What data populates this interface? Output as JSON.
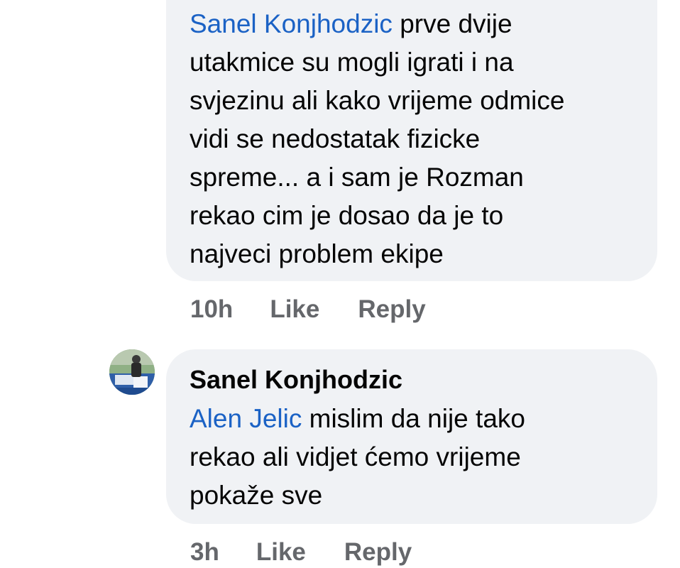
{
  "comments": [
    {
      "mention": "Sanel Konjhodzic",
      "text_line1_rest": " prve dvije",
      "text_lines": [
        "utakmice su mogli igrati i na",
        "svjezinu ali kako vrijeme odmice",
        "vidi se nedostatak fizicke",
        "spreme... a i sam je Rozman",
        "rekao cim je dosao da je to",
        "najveci problem ekipe"
      ],
      "time": "10h",
      "like_label": "Like",
      "reply_label": "Reply"
    },
    {
      "author": "Sanel Konjhodzic",
      "mention": "Alen Jelic",
      "text_line1_rest": " mislim da nije tako",
      "text_lines": [
        "rekao ali vidjet ćemo vrijeme",
        "pokaže sve"
      ],
      "time": "3h",
      "like_label": "Like",
      "reply_label": "Reply"
    }
  ],
  "colors": {
    "bubble_bg": "#f0f2f5",
    "mention": "#1b62c5",
    "meta_text": "#65676b"
  }
}
